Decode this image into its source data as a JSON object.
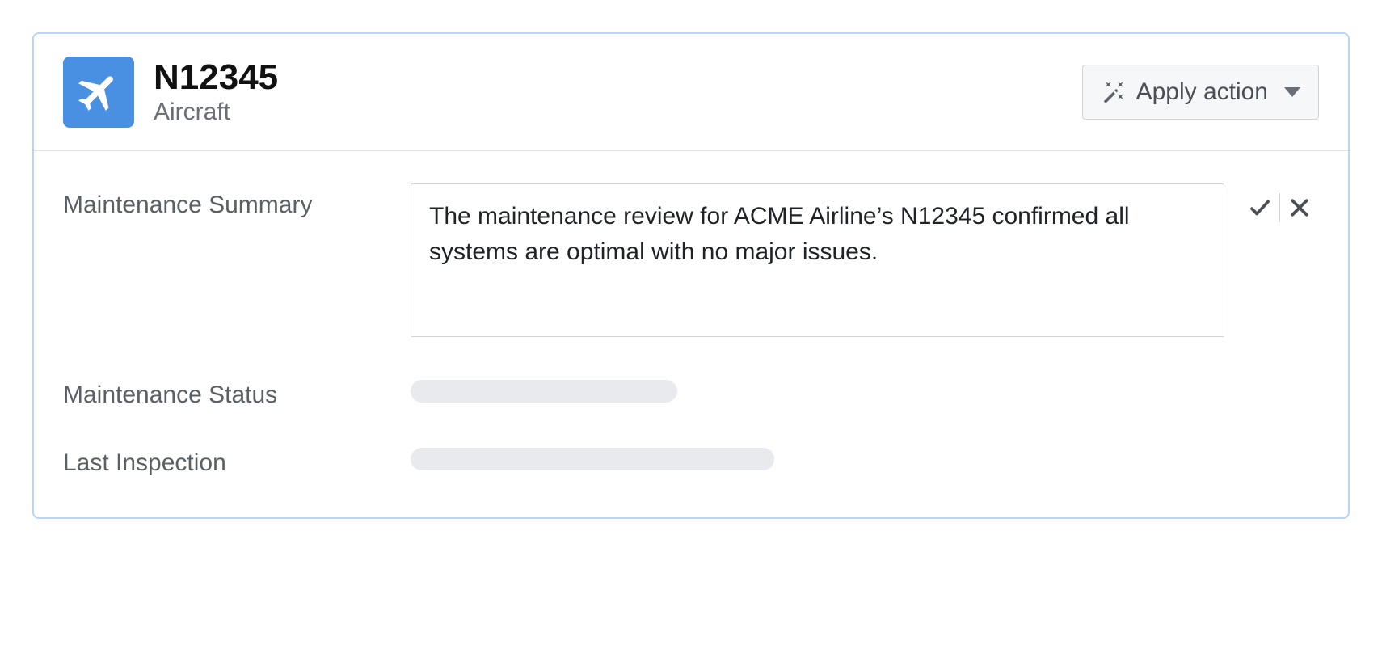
{
  "header": {
    "title": "N12345",
    "subtitle": "Aircraft",
    "apply_action_label": "Apply action"
  },
  "fields": {
    "maintenance_summary": {
      "label": "Maintenance Summary",
      "value": "The maintenance review for ACME Airline’s N12345 confirmed all systems are optimal with no major issues."
    },
    "maintenance_status": {
      "label": "Maintenance Status"
    },
    "last_inspection": {
      "label": "Last Inspection"
    }
  }
}
